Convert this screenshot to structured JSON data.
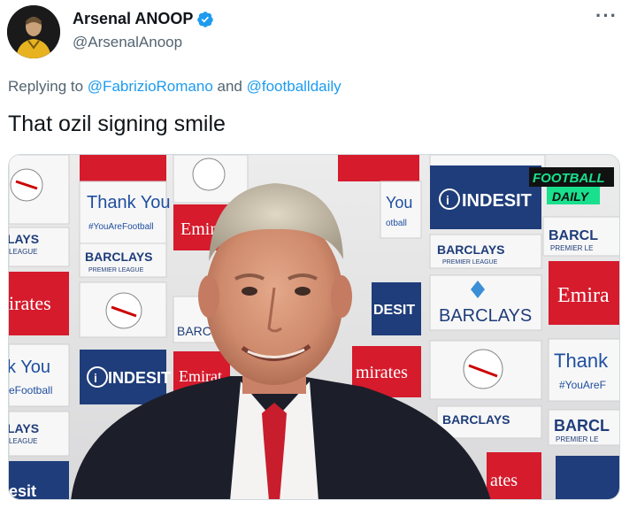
{
  "tweet": {
    "display_name": "Arsenal ANOOP",
    "handle": "@ArsenalAnoop",
    "verified": true,
    "more_icon": "more-horizontal-icon",
    "replying_prefix": "Replying to",
    "reply_mention_1": "@FabrizioRomano",
    "reply_joiner": "and",
    "reply_mention_2": "@footballdaily",
    "text": "That ozil signing smile"
  },
  "media": {
    "badge_line1": "FOOTBALL",
    "badge_line2": "DAILY",
    "board_texts": [
      "Thank You",
      "#YouAreFootball",
      "Emirates",
      "BARCLAYS",
      "PREMIER LEAGUE",
      "INDESIT",
      "You",
      "otball",
      "DESIT",
      "irates",
      "k You",
      "eFootball",
      "Thank",
      "#YouAreF",
      "BARCL",
      "PREMIER LE",
      "Emira",
      "LAYS",
      "LEAGUE",
      "esit",
      "ates",
      "mirates",
      "Emirat"
    ]
  },
  "colors": {
    "accent": "#1d9bf0",
    "text": "#0f1419",
    "secondary": "#536471",
    "emirates_red": "#d51b2c",
    "barclays_navy": "#1f3d7a",
    "badge_green": "#19e08c"
  }
}
